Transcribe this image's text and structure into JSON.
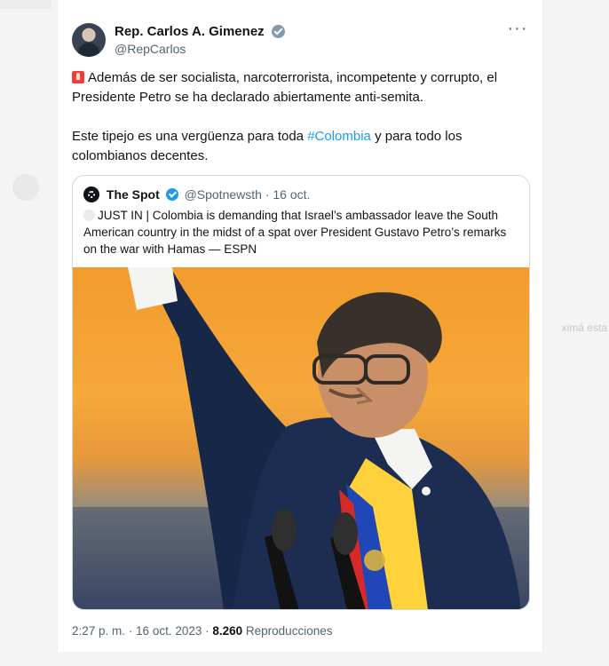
{
  "tweet": {
    "author": {
      "display_name": "Rep. Carlos A. Gimenez",
      "handle": "@RepCarlos",
      "verified_badge": "government-verified-icon"
    },
    "more_label": "···",
    "body": {
      "paragraph1_rest": "Además de ser socialista, narcoterrorista, incompetente y corrupto, el Presidente Petro se ha declarado abiertamente anti-semita.",
      "paragraph2_before": "Este tipejo es una vergüenza para toda ",
      "hashtag": "#Colombia",
      "paragraph2_after": " y para todo los colombianos decentes."
    },
    "quote": {
      "name": "The Spot",
      "handle": "@Spotnewsth",
      "dot": " · ",
      "date": "16 oct.",
      "text": "JUST IN | Colombia is demanding that Israel’s ambassador leave the South American country in the midst of a spat over President Gustavo Petro’s remarks on the war with Hamas — ESPN"
    },
    "meta": {
      "time": "2:27 p. m.",
      "sep1": " · ",
      "date": "16 oct. 2023",
      "sep2": " · ",
      "views_count": "8.260",
      "views_label": " Reproducciones"
    }
  },
  "colors": {
    "link": "#1d9bf0",
    "muted": "#536471",
    "text": "#0f1419",
    "border": "#cfd9de"
  },
  "icons": {
    "siren": "siren-icon",
    "more": "more-horizontal-icon",
    "quote_avatar": "spot-logo-icon",
    "quote_verified": "blue-verified-icon"
  }
}
